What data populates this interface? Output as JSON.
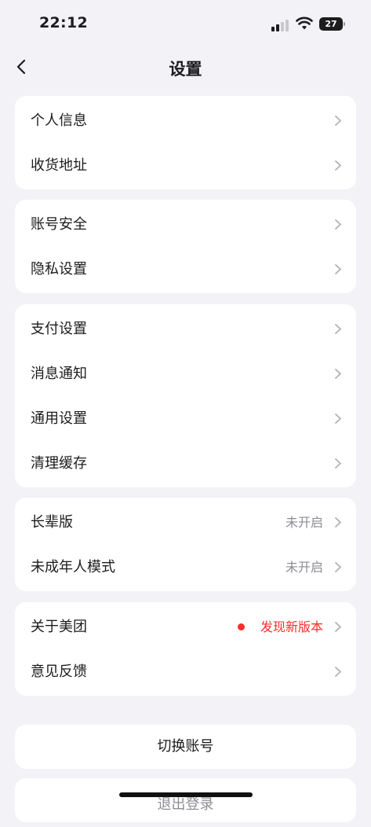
{
  "status": {
    "time": "22:12",
    "battery": "27"
  },
  "nav": {
    "title": "设置"
  },
  "groups": [
    {
      "rows": [
        {
          "label": "个人信息"
        },
        {
          "label": "收货地址"
        }
      ]
    },
    {
      "rows": [
        {
          "label": "账号安全"
        },
        {
          "label": "隐私设置"
        }
      ]
    },
    {
      "rows": [
        {
          "label": "支付设置"
        },
        {
          "label": "消息通知"
        },
        {
          "label": "通用设置"
        },
        {
          "label": "清理缓存"
        }
      ]
    },
    {
      "rows": [
        {
          "label": "长辈版",
          "value": "未开启"
        },
        {
          "label": "未成年人模式",
          "value": "未开启"
        }
      ]
    },
    {
      "rows": [
        {
          "label": "关于美团",
          "value": "发现新版本"
        },
        {
          "label": "意见反馈"
        }
      ]
    }
  ],
  "buttons": {
    "switch_account": "切换账号",
    "logout": "退出登录"
  },
  "colors": {
    "background": "#f2f2f7",
    "accent_red": "#ff2d2d",
    "secondary_text": "#8e8e93"
  }
}
